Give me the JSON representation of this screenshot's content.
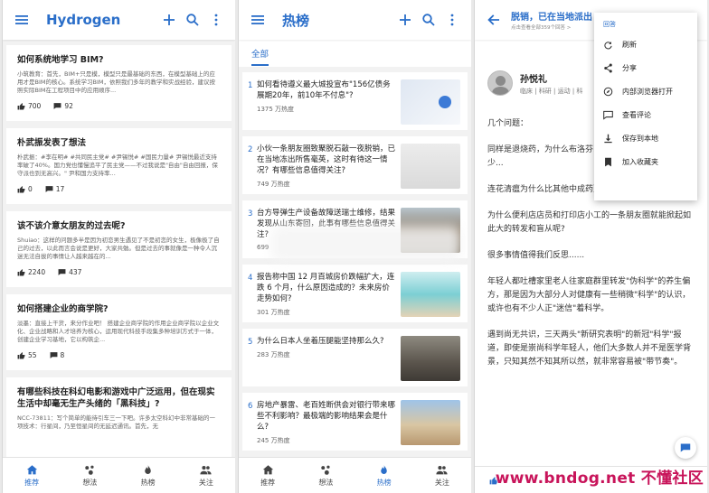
{
  "colors": {
    "accent": "#2a6ec9",
    "watermark": "#c8145a"
  },
  "bottom_nav": [
    "推荐",
    "想法",
    "热榜",
    "关注"
  ],
  "screen1": {
    "title": "Hydrogen",
    "cards": [
      {
        "title": "如何系统地学习 BIM?",
        "excerpt": "小筑教育：首先，BIM+只是模，模型只是最基础的东西，在模型基础上的应用才是BIM的核心。系统学习BIM，依照我们多年的教学和实战经验，建议按照实际BIM在工程项目中的应用顺序...",
        "likes": "700",
        "comments": "92"
      },
      {
        "title": "朴武振发表了想法",
        "excerpt": "朴武振：#李在明# #共同民主党# #尹锡悦# #国民力量# 尹锡悦最近支持率破了40%。国力党也懂慢追平了民主党——不过我说是\"自由\"自由回报，保守派也到无高兴。\" 尹和国力支持率...",
        "likes": "0",
        "comments": "17"
      },
      {
        "title": "该不该介意女朋友的过去呢?",
        "excerpt": "Shuiao：这样的问题多半是因为初恋男生遇见了不是初恋的女生，极像极了自己的过去，以此而言会说是更好，大家共勉。但是过去的事就像是一种令人沉迷无法自拔的事情让人越来越在的...",
        "likes": "2240",
        "comments": "437"
      },
      {
        "title": "如何搭建企业的商学院?",
        "excerpt": "淡墨：直接上干货，来分作业吧！ 搭建企业商学院的作用企业商学院以企业文化、企业战略和人才培养为核心，运用现代科技手段集多种培训方式于一体，创建企业学习基地，它以构筑企...",
        "likes": "55",
        "comments": "8"
      },
      {
        "title": "有哪些科技在科幻电影和游戏中广泛运用，但在现实生活中却毫无生产头绪的「黑科技」?",
        "excerpt": "NCC-73811：写个简单的能待引车三一下吧。许多太空科幻中非常基础的一项技术：行星间，乃至恒星间的无延迟通讯。首先，无",
        "likes": "",
        "comments": ""
      }
    ]
  },
  "screen2": {
    "title": "热榜",
    "tab": "全部",
    "items": [
      {
        "rank": "1",
        "title": "如何看待遵义最大城投宣布\"156亿债务展期20年，前10年不付息\"?",
        "heat": "1375 万热度"
      },
      {
        "rank": "2",
        "title": "小伙一条朋友圈致聚脱石敲一夜脱销，已在当地冻出所售毫英，这时有待这一情况？有哪些信息值得关注?",
        "heat": "749 万热度"
      },
      {
        "rank": "3",
        "title": "台方导弹生产设备故障送瑞士维修，结果发现从山东寄回，此事有哪些信息值得关注?",
        "heat": "699"
      },
      {
        "rank": "4",
        "title": "报告称中国 12 月百城房价跌幅扩大，连跌 6 个月，什么原因造成的？未来房价走势如何?",
        "heat": "301 万热度"
      },
      {
        "rank": "5",
        "title": "为什么日本人坐着压腿能坚持那么久?",
        "heat": "283 万热度"
      },
      {
        "rank": "6",
        "title": "房地产暴雷、老百姓断供会对银行带来哪些不利影响？最极端的影响结果会是什么?",
        "heat": "245 万热度"
      }
    ]
  },
  "screen3": {
    "question_title": "脱销，已在当地派出",
    "question_sub": "点击查看全部359个回答 >",
    "author_name": "孙悦礼",
    "author_desc": "临床 | 科研 | 运动 | 科",
    "paragraphs": [
      "几个问题：",
      "同样是退烧药，为什么布洛芬... 搜，而对乙酰氨基酚就很少...",
      "连花清瘟为什么比其他中成药更多被人们讨论呢?",
      "为什么便利店店员和打印店小工的一条朋友圈就能掀起如此大的转发和盲从呢?",
      "很多事情值得我们反思......",
      "年轻人都吐槽家里老人往家庭群里转发\"伪科学\"的养生偏方，那是因为大部分人对健康有一些稍微\"科学\"的认识，或许也有不少人正\"迷信\"着科学。",
      "遇到尚无共识，三天两头\"新研究表明\"的新冠\"科学\"报道，即使是崇尚科学年轻人，他们大多数人并不是医学背景，只知其然不知其所以然，就非常容易被\"带节奏\"。"
    ],
    "bottom_count": "4",
    "menu_header": "回答",
    "menu_items": [
      "刷新",
      "分享",
      "内部浏览器打开",
      "查看评论",
      "保存到本地",
      "加入收藏夹"
    ]
  },
  "watermark": "www.bndog.net 不懂社区"
}
